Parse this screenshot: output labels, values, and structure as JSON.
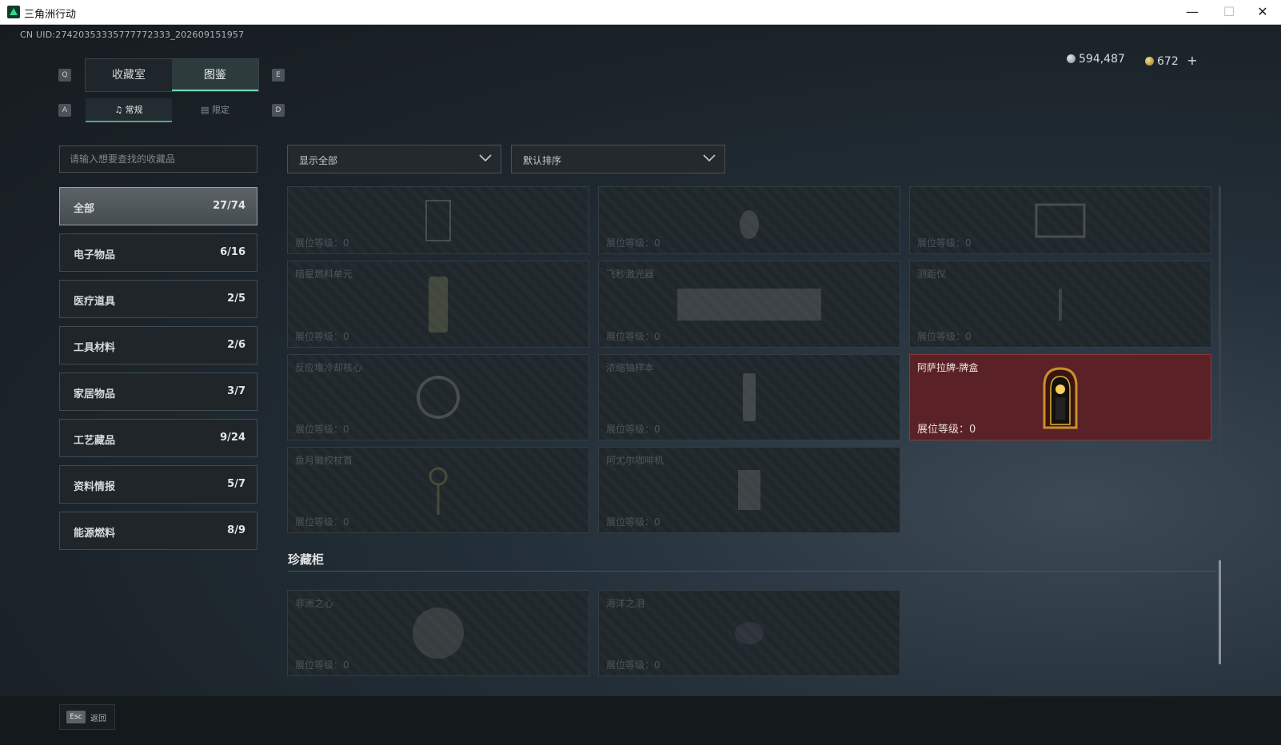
{
  "window": {
    "title": "三角洲行动"
  },
  "header": {
    "uid": "CN UID:27420353335777772333_202609151957"
  },
  "tabs": [
    {
      "label": "收藏室",
      "key": "Q"
    },
    {
      "label": "图鉴",
      "key": "E"
    }
  ],
  "subtabs": [
    {
      "label": "常规",
      "key": "A"
    },
    {
      "label": "限定",
      "key": "D"
    }
  ],
  "search": {
    "placeholder": "请输入想要查找的收藏品"
  },
  "categories": [
    {
      "label": "全部",
      "count": "27/74"
    },
    {
      "label": "电子物品",
      "count": "6/16"
    },
    {
      "label": "医疗道具",
      "count": "2/5"
    },
    {
      "label": "工具材料",
      "count": "2/6"
    },
    {
      "label": "家居物品",
      "count": "3/7"
    },
    {
      "label": "工艺藏品",
      "count": "9/24"
    },
    {
      "label": "资料情报",
      "count": "5/7"
    },
    {
      "label": "能源燃料",
      "count": "8/9"
    }
  ],
  "filters": {
    "display": "显示全部",
    "sort": "默认排序"
  },
  "currency": {
    "silver": "594,487",
    "gold": "672",
    "add": "+"
  },
  "items": [
    {
      "name": "",
      "level": "展位等级：0"
    },
    {
      "name": "",
      "level": "展位等级：0"
    },
    {
      "name": "",
      "level": "展位等级：0"
    },
    {
      "name": "暗星燃料单元",
      "level": "展位等级：0"
    },
    {
      "name": "飞秒激光器",
      "level": "展位等级：0"
    },
    {
      "name": "测距仪",
      "level": "展位等级：0"
    },
    {
      "name": "反应堆冷却核心",
      "level": "展位等级：0"
    },
    {
      "name": "浓缩铀样本",
      "level": "展位等级：0"
    },
    {
      "name": "阿萨拉牌-牌盒",
      "level": "展位等级：0"
    },
    {
      "name": "鱼月徽权杖首",
      "level": "展位等级：0"
    },
    {
      "name": "阿尤尔咖啡机",
      "level": "展位等级：0"
    }
  ],
  "section": {
    "title": "珍藏柜"
  },
  "treasures": [
    {
      "name": "非洲之心",
      "level": "展位等级：0"
    },
    {
      "name": "海洋之泪",
      "level": "展位等级：0"
    }
  ],
  "footer": {
    "key": "Esc",
    "label": "返回"
  },
  "colors": {
    "accent": "#6fd9b3",
    "highlight_card": "#5a2226"
  }
}
